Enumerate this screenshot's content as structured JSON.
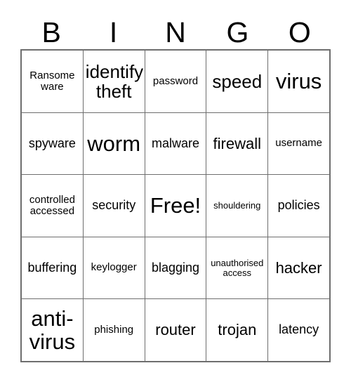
{
  "card": {
    "title": "BINGO",
    "header_letters": [
      "B",
      "I",
      "N",
      "G",
      "O"
    ],
    "grid": {
      "columns": 5,
      "rows": 5,
      "border_color": "#6e6e6e",
      "background": "#ffffff",
      "text_color": "#000000",
      "free_space": "Free!",
      "cells": [
        [
          {
            "text": "Ransome\nware",
            "size": "sm"
          },
          {
            "text": "identify\ntheft",
            "size": "xl"
          },
          {
            "text": "password",
            "size": "sm"
          },
          {
            "text": "speed",
            "size": "xl"
          },
          {
            "text": "virus",
            "size": "xxl"
          }
        ],
        [
          {
            "text": "spyware",
            "size": "md"
          },
          {
            "text": "worm",
            "size": "xxl"
          },
          {
            "text": "malware",
            "size": "md"
          },
          {
            "text": "firewall",
            "size": "lg"
          },
          {
            "text": "username",
            "size": "sm"
          }
        ],
        [
          {
            "text": "controlled\naccessed",
            "size": "sm"
          },
          {
            "text": "security",
            "size": "md"
          },
          {
            "text": "Free!",
            "size": "xxl"
          },
          {
            "text": "shouldering",
            "size": "xs"
          },
          {
            "text": "policies",
            "size": "md"
          }
        ],
        [
          {
            "text": "buffering",
            "size": "md"
          },
          {
            "text": "keylogger",
            "size": "sm"
          },
          {
            "text": "blagging",
            "size": "md"
          },
          {
            "text": "unauthorised\naccess",
            "size": "xs"
          },
          {
            "text": "hacker",
            "size": "lg"
          }
        ],
        [
          {
            "text": "anti-\nvirus",
            "size": "xxl"
          },
          {
            "text": "phishing",
            "size": "sm"
          },
          {
            "text": "router",
            "size": "lg"
          },
          {
            "text": "trojan",
            "size": "lg"
          },
          {
            "text": "latency",
            "size": "md"
          }
        ]
      ]
    }
  }
}
